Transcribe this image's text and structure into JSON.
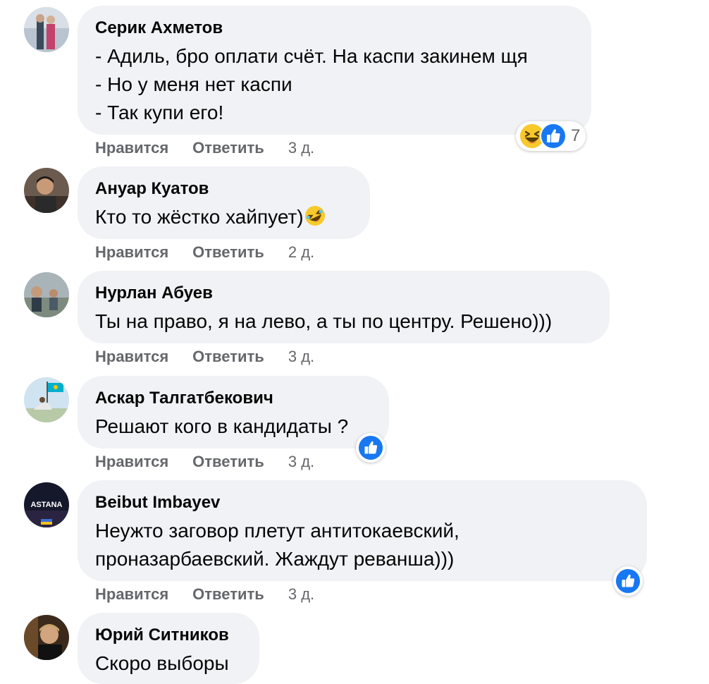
{
  "actions": {
    "like": "Нравится",
    "reply": "Ответить"
  },
  "comments": [
    {
      "author": "Серик Ахметов",
      "lines": [
        "- Адиль, бро оплати счёт. На каспи закинем щя",
        "- Но у меня нет каспи",
        "- Так купи его!"
      ],
      "time": "3 д.",
      "reactions": {
        "icons": [
          "haha-icon",
          "like-icon"
        ],
        "count": "7"
      }
    },
    {
      "author": "Ануар Куатов",
      "lines": [
        "Кто то жёстко хайпует)"
      ],
      "trailing_emoji": "rofl-emoji",
      "time": "2 д."
    },
    {
      "author": "Нурлан Абуев",
      "lines": [
        "Ты на право, я на лево, а ты по центру. Решено)))"
      ],
      "time": "3 д."
    },
    {
      "author": "Аскар Талгатбекович",
      "lines": [
        "Решают кого в кандидаты ?"
      ],
      "time": "3 д.",
      "reactions": {
        "icons": [
          "like-icon"
        ]
      }
    },
    {
      "author": "Beibut Imbayev",
      "lines": [
        "Неужто заговор плетут антитокаевский,",
        "проназарбаевский. Жаждут реванша)))"
      ],
      "time": "3 д.",
      "reactions": {
        "icons": [
          "like-icon"
        ]
      }
    },
    {
      "author": "Юрий Ситников",
      "lines": [
        "Скоро выборы"
      ]
    }
  ],
  "avatars": {
    "c4_text": "ASTANA"
  },
  "colors": {
    "bubble_bg": "#f0f2f5",
    "meta_text": "#65676b",
    "like_blue": "#1877f2",
    "haha_yellow": "#f7c92b"
  }
}
